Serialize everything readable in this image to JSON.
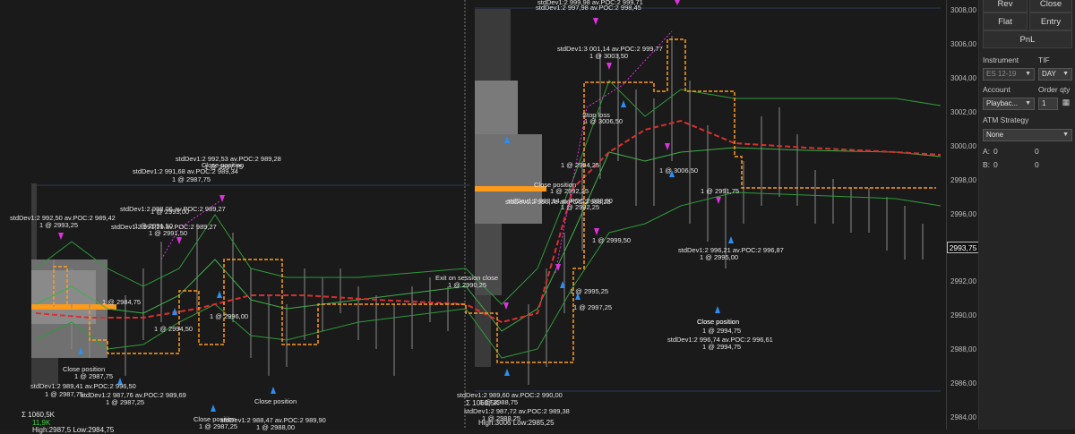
{
  "chart": {
    "stats": {
      "sum_label": "Σ 1060,5K",
      "delta_label": "11,9K",
      "high_low_label": "High:2987,5 Low:2984,75",
      "sum_label_2": "Σ 1060,5K",
      "high_low_label_2": "High:3006 Low:2985,25"
    },
    "annotations": [
      "stdDev1:2 999,98 av.POC:2 999,71",
      "stdDev1:2 997,98 av.POC:2 998,45",
      "stdDev1:3 001,14 av.POC:2 999,77",
      "1 @ 3003,50",
      "Stop loss",
      "1 @ 3006,50",
      "Close position",
      "1 @ 2992,25",
      "stdDev1:2 993,14 av.POC:2 988,00",
      "1 @ 2994,25",
      "stdDev1:2 990,76 av.POC:2 988,25",
      "1 @ 2992,25",
      "1 @ 2999,50",
      "1 @ 2995,25",
      "1 @ 2997,25",
      "1 @ 3006,50",
      "1 @ 2991,75",
      "stdDev1:2 996,21 av.POC:2 996,87",
      "1 @ 2995,00",
      "Close position",
      "1 @ 2994,75",
      "stdDev1:2 996,74 av.POC:2 996,61",
      "1 @ 2994,75",
      "Exit on session close",
      "1 @ 2990,25",
      "stdDev1:2 989,60 av.POC:2 990,00",
      "1 @ 2988,75",
      "stdDev1:2 987,72 av.POC:2 989,38",
      "1 @ 2988,25",
      "Close position",
      "1 @ 2987,75",
      "stdDev1:2 992,53 av.POC:2 989,28",
      "1 @ 2987,75",
      "stdDev1:2 991,68 av.POC:2 989,34",
      "1 @ 2993,00",
      "stdDev1:2 988,06 av.POC:2 989,27",
      "1 @ 2991,50",
      "stdDev1:2 991,29 av.POC:2 989,27",
      "1 @ 2991,50",
      "stdDev1:2 992,50 av.POC:2 989,42",
      "1 @ 2993,25",
      "1 @ 2984,75",
      "1 @ 2994,50",
      "1 @ 2996,00",
      "Close position",
      "1 @ 2987,75",
      "stdDev1:2 989,41 av.POC:2 996,50",
      "1 @ 2987,75",
      "stdDev1:2 987,76 av.POC:2 989,69",
      "1 @ 2987,25",
      "Close position",
      "1 @ 2987,25",
      "stdDev1:2 988,47 av.POC:2 989,90",
      "1 @ 2988,00",
      "Close position",
      "Close position"
    ]
  },
  "price_axis": {
    "ticks": [
      "3008,00",
      "3006,00",
      "3004,00",
      "3002,00",
      "3000,00",
      "2998,00",
      "2996,00",
      "2994,00",
      "2992,00",
      "2990,00",
      "2988,00",
      "2986,00",
      "2984,00"
    ],
    "last_price": "2993,75"
  },
  "panel": {
    "rev_label": "Rev",
    "close_label": "Close",
    "flat_label": "Flat",
    "entry_label": "Entry",
    "pnl_label": "PnL",
    "instrument_label": "Instrument",
    "tif_label": "TIF",
    "instrument_value": "ES 12-19",
    "tif_value": "DAY",
    "account_label": "Account",
    "order_qty_label": "Order qty",
    "account_value": "Playbac...",
    "order_qty_value": "1",
    "atm_label": "ATM Strategy",
    "atm_value": "None",
    "a_label": "A:",
    "a_val1": "0",
    "a_val2": "0",
    "b_label": "B:",
    "b_val1": "0",
    "b_val2": "0"
  },
  "colors": {
    "background": "#1a1a1a",
    "orange": "#ff9a1a",
    "red_ma": "#d83030",
    "green": "#2f9a3a",
    "magenta": "#e030e0",
    "blue_arrow": "#2a8ff0"
  }
}
